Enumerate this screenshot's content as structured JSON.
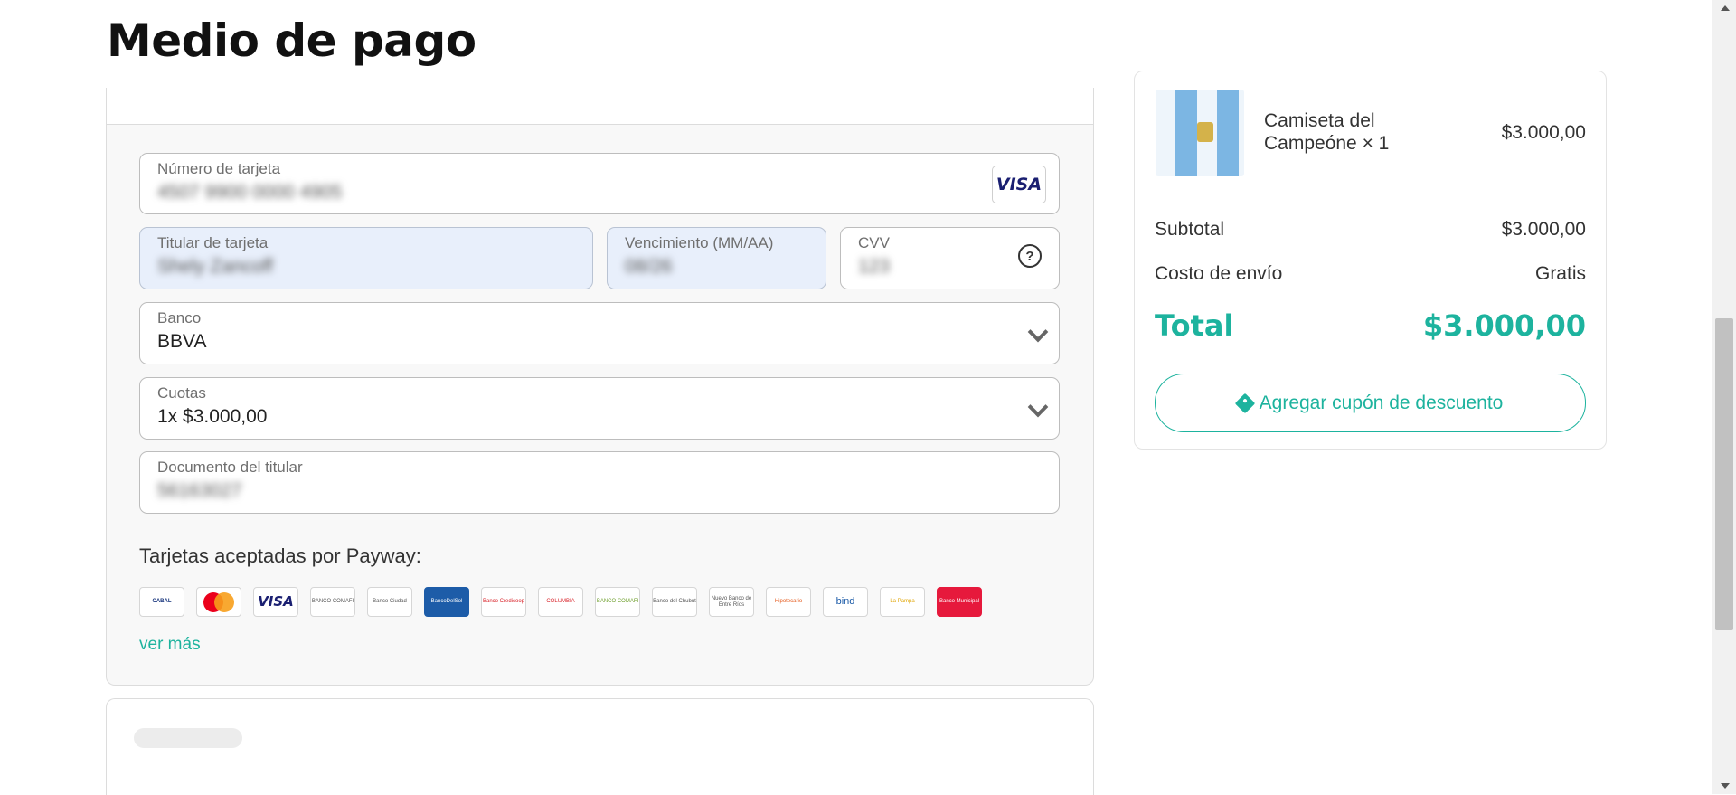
{
  "page": {
    "title": "Medio de pago"
  },
  "payment_form": {
    "card_number": {
      "label": "Número de tarjeta",
      "value": "4507 9900 0000 4905",
      "brand": "VISA"
    },
    "holder": {
      "label": "Titular de tarjeta",
      "value": "Shely Zancoff"
    },
    "expiry": {
      "label": "Vencimiento (MM/AA)",
      "value": "08/26"
    },
    "cvv": {
      "label": "CVV",
      "value": "123",
      "help": "?"
    },
    "bank": {
      "label": "Banco",
      "value": "BBVA"
    },
    "installments": {
      "label": "Cuotas",
      "value": "1x $3.000,00"
    },
    "document": {
      "label": "Documento del titular",
      "value": "56163027"
    }
  },
  "accepted_cards": {
    "title": "Tarjetas aceptadas por Payway:",
    "logos": [
      {
        "name": "Cabal",
        "text": "CABAL",
        "icon": "cabal-logo"
      },
      {
        "name": "Mastercard",
        "text": "",
        "icon": "mastercard-logo"
      },
      {
        "name": "Visa",
        "text": "VISA",
        "icon": "visa-logo"
      },
      {
        "name": "Banco Comafi",
        "text": "BANCO COMAFI",
        "icon": "bank-logo"
      },
      {
        "name": "Banco Ciudad",
        "text": "Banco Ciudad",
        "icon": "bank-logo"
      },
      {
        "name": "BancoDelSol",
        "text": "BancoDelSol",
        "icon": "bank-logo"
      },
      {
        "name": "Banco Credicoop",
        "text": "Banco Credicoop",
        "icon": "bank-logo"
      },
      {
        "name": "Banco Columbia",
        "text": "COLUMBIA",
        "icon": "bank-logo"
      },
      {
        "name": "Banco Comafi",
        "text": "BANCO COMAFI",
        "icon": "bank-logo"
      },
      {
        "name": "Banco del Chubut",
        "text": "Banco del Chubut",
        "icon": "bank-logo"
      },
      {
        "name": "Nuevo Banco de Entre Ríos",
        "text": "Nuevo Banco de Entre Ríos",
        "icon": "bank-logo"
      },
      {
        "name": "Banco Hipotecario",
        "text": "Hipotecario",
        "icon": "bank-logo"
      },
      {
        "name": "bind",
        "text": "bind",
        "icon": "bank-logo"
      },
      {
        "name": "Banco de La Pampa",
        "text": "La Pampa",
        "icon": "bank-logo"
      },
      {
        "name": "Banco Municipal",
        "text": "Banco Municipal",
        "icon": "bank-logo"
      }
    ],
    "see_more": "ver más"
  },
  "summary": {
    "product": {
      "name": "Camiseta del Campeóne × 1",
      "price": "$3.000,00"
    },
    "subtotal": {
      "label": "Subtotal",
      "value": "$3.000,00"
    },
    "shipping": {
      "label": "Costo de envío",
      "value": "Gratis"
    },
    "total": {
      "label": "Total",
      "value": "$3.000,00"
    },
    "coupon_button": "Agregar cupón de descuento"
  },
  "colors": {
    "accent": "#1db39e",
    "autofill": "#e8effb"
  }
}
